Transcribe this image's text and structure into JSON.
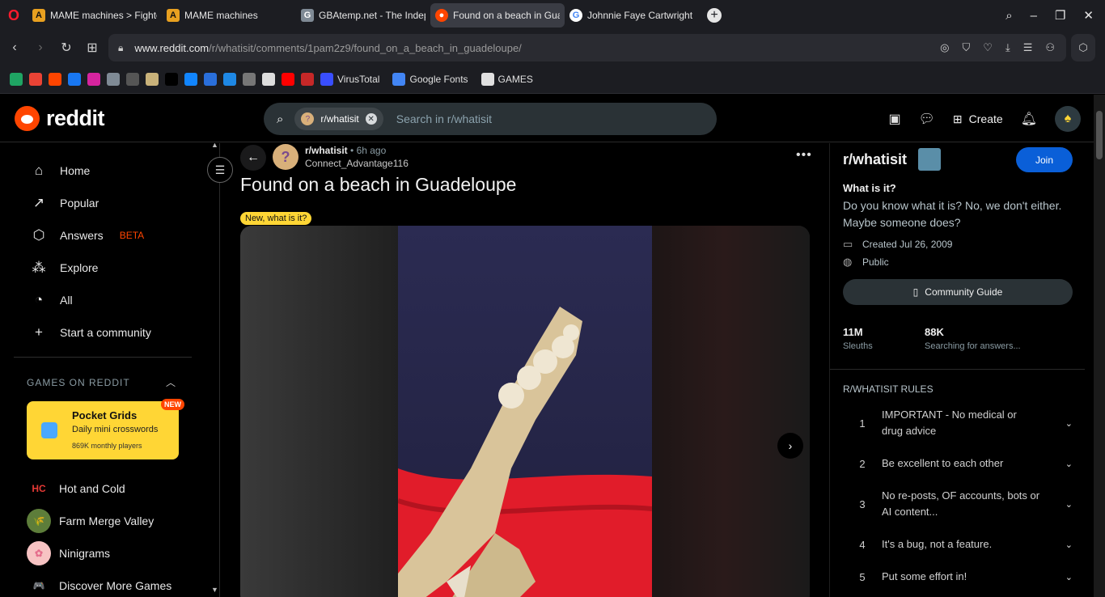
{
  "browser": {
    "tabs": [
      {
        "title": "MAME machines > Fighte",
        "favicon": "A",
        "color": "#e8a020"
      },
      {
        "title": "MAME machines",
        "favicon": "A",
        "color": "#e8a020"
      },
      {
        "title": "GBAtemp.net - The Indepe",
        "favicon": "gbatemp-icon",
        "color": "#7f8a95"
      },
      {
        "title": "Found on a beach in Guad",
        "favicon": "reddit-icon",
        "color": "#ff4500",
        "active": true
      },
      {
        "title": "Johnnie Faye Cartwright -",
        "favicon": "G",
        "color": "#4285f4"
      }
    ],
    "url_host": "www.reddit.com",
    "url_path": "/r/whatisit/comments/1pam2z9/found_on_a_beach_in_guadeloupe/",
    "bookmarks": [
      {
        "icon": "drive-icon",
        "color": "#1fa463"
      },
      {
        "icon": "gmail-icon",
        "color": "#ea4335"
      },
      {
        "icon": "reddit-icon",
        "color": "#ff4500"
      },
      {
        "icon": "facebook-icon",
        "color": "#1877f2"
      },
      {
        "icon": "instagram-icon",
        "color": "#d6249f"
      },
      {
        "icon": "cat-icon",
        "color": "#7f8a95"
      },
      {
        "icon": "openai-icon",
        "color": "#555"
      },
      {
        "icon": "ring-icon",
        "color": "#c9b27a"
      },
      {
        "icon": "x-icon",
        "color": "#000"
      },
      {
        "icon": "bluesky-icon",
        "color": "#1185fe"
      },
      {
        "icon": "arc-icon",
        "color": "#2a6fdb"
      },
      {
        "icon": "p-icon",
        "color": "#1e88e5"
      },
      {
        "icon": "mask-icon",
        "color": "#777"
      },
      {
        "icon": "museum-icon",
        "color": "#ddd"
      },
      {
        "icon": "youtube-icon",
        "color": "#ff0000"
      },
      {
        "icon": "arrow-icon",
        "color": "#c62828"
      }
    ],
    "bookmark_labels": [
      {
        "icon": "virustotal-icon",
        "label": "VirusTotal",
        "color": "#394eff"
      },
      {
        "icon": "google-fonts-icon",
        "label": "Google Fonts",
        "color": "#4285f4"
      },
      {
        "icon": "folder-icon",
        "label": "GAMES",
        "color": "#e0e0e0"
      }
    ]
  },
  "header": {
    "logo": "reddit",
    "search_chip": "r/whatisit",
    "search_placeholder": "Search in r/whatisit",
    "create": "Create"
  },
  "nav": {
    "items": [
      {
        "label": "Home",
        "icon": "⌂"
      },
      {
        "label": "Popular",
        "icon": "↗"
      },
      {
        "label": "Answers",
        "icon": "⬡",
        "badge": "BETA"
      },
      {
        "label": "Explore",
        "icon": "⁂"
      },
      {
        "label": "All",
        "icon": "◔"
      },
      {
        "label": "Start a community",
        "icon": "+"
      }
    ],
    "games_heading": "GAMES ON REDDIT",
    "promo": {
      "title": "Pocket Grids",
      "subtitle": "Daily mini crosswords",
      "players": "869K monthly players",
      "badge": "NEW"
    },
    "games": [
      {
        "label": "Hot and Cold",
        "icon": "HC"
      },
      {
        "label": "Farm Merge Valley",
        "icon": "🌾"
      },
      {
        "label": "Ninigrams",
        "icon": "✿"
      },
      {
        "label": "Discover More Games",
        "icon": "🎮"
      }
    ]
  },
  "post": {
    "subreddit": "r/whatisit",
    "age": "6h ago",
    "author": "Connect_Advantage116",
    "title": "Found on a beach in Guadeloupe",
    "flair": "New, what is it?"
  },
  "sidebar": {
    "name": "r/whatisit",
    "join": "Join",
    "heading": "What is it?",
    "description": "Do you know what it is? No, we don't either. Maybe someone does?",
    "created": "Created Jul 26, 2009",
    "visibility": "Public",
    "guide": "Community Guide",
    "stats": [
      {
        "value": "11M",
        "label": "Sleuths"
      },
      {
        "value": "88K",
        "label": "Searching for answers..."
      }
    ],
    "rules_heading": "R/WHATISIT RULES",
    "rules": [
      {
        "n": "1",
        "text": "IMPORTANT - No medical or drug advice"
      },
      {
        "n": "2",
        "text": "Be excellent to each other"
      },
      {
        "n": "3",
        "text": "No re-posts, OF accounts, bots or AI content..."
      },
      {
        "n": "4",
        "text": "It's a bug, not a feature."
      },
      {
        "n": "5",
        "text": "Put some effort in!"
      }
    ]
  }
}
